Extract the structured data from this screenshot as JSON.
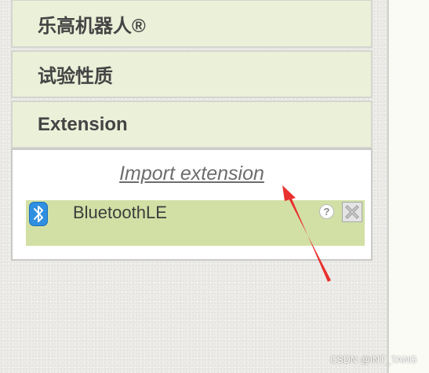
{
  "palette": {
    "drawers": [
      {
        "label": "乐高机器人®"
      },
      {
        "label": "试验性质"
      },
      {
        "label": "Extension"
      }
    ],
    "extension": {
      "import_label": "Import extension",
      "components": [
        {
          "name": "BluetoothLE",
          "icon": "bluetooth-icon",
          "help_glyph": "?"
        }
      ]
    }
  },
  "watermark": "CSDN @INT_TANG",
  "colors": {
    "drawer_background": "#ebf0d9",
    "component_highlight": "#d2e0a5",
    "annotation_arrow": "#e8322f"
  }
}
